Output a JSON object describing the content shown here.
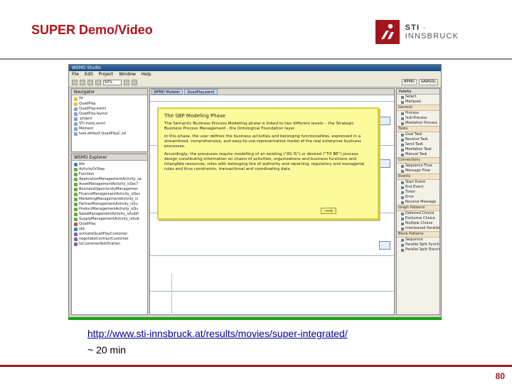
{
  "slide": {
    "title": "SUPER Demo/Video",
    "logo_text_bold": "STI",
    "logo_text": " · INNSBRUCK",
    "page_number": "80",
    "link": "http://www.sti-innsbruck.at/results/movies/super-integrated/",
    "duration": "~ 20 min",
    "accent_color": "#a3151c"
  },
  "app": {
    "window_title": "WSMO Studio",
    "menu": [
      "File",
      "Edit",
      "Project",
      "Window",
      "Help"
    ],
    "zoom": "50%",
    "perspectives": [
      "BPMO",
      "SAWSDL"
    ],
    "navigator": {
      "tab_label": "Navigator",
      "items": [
        {
          "label": "TP",
          "icon": "folder-icon"
        },
        {
          "label": "QuadPlay",
          "icon": "folder-icon"
        },
        {
          "label": "QuadPlay.ewml",
          "icon": "file-icon"
        },
        {
          "label": "QuadPlay.layout",
          "icon": "file-icon"
        },
        {
          "label": ".project",
          "icon": "file-icon"
        },
        {
          "label": "STI-meta.wsml",
          "icon": "file-icon"
        },
        {
          "label": "Moment",
          "icon": "file-icon"
        },
        {
          "label": "task.default.QuadPlayC.sd",
          "icon": "file-icon"
        }
      ]
    },
    "explorer": {
      "tab_label": "WSMO Explorer",
      "items": [
        {
          "label": "bfe",
          "icon": "ontology-icon"
        },
        {
          "label": "ActivityOrStep",
          "icon": "concept-icon"
        },
        {
          "label": "Function",
          "icon": "concept-icon"
        },
        {
          "label": "ApplicationManagementActivity_sa",
          "icon": "concept-icon"
        },
        {
          "label": "AssetManagementActivity_isSec?",
          "icon": "concept-icon"
        },
        {
          "label": "BusinessOpportunityManagemen",
          "icon": "concept-icon"
        },
        {
          "label": "FinanceManagementActivity_isSec",
          "icon": "concept-icon"
        },
        {
          "label": "MarketingManagementActivity_is",
          "icon": "concept-icon"
        },
        {
          "label": "PartnerManagementActivity_isSu",
          "icon": "concept-icon"
        },
        {
          "label": "ProductManagementActivity_isSu",
          "icon": "concept-icon"
        },
        {
          "label": "SalesManagementActivity_isSubP",
          "icon": "concept-icon"
        },
        {
          "label": "SupplyManagementActivity_isSub",
          "icon": "concept-icon"
        },
        {
          "label": "QuadPlay",
          "icon": "process-icon"
        },
        {
          "label": "sbc",
          "icon": "ontology-icon"
        },
        {
          "label": "activateQuadPlayCustomer",
          "icon": "instance-icon"
        },
        {
          "label": "negotiateContractCustomer",
          "icon": "instance-icon"
        },
        {
          "label": "toCustomerNotification",
          "icon": "instance-icon"
        }
      ]
    },
    "editor_tabs": [
      "BPMO Modeler",
      "QuadPlay.ewml"
    ],
    "palette": {
      "title": "Palette",
      "entries": [
        {
          "kind": "item",
          "label": "Select"
        },
        {
          "kind": "item",
          "label": "Marquee"
        },
        {
          "kind": "group",
          "label": "General"
        },
        {
          "kind": "item",
          "label": "Process"
        },
        {
          "kind": "item",
          "label": "Sub-Process"
        },
        {
          "kind": "item",
          "label": "Mediation Process"
        },
        {
          "kind": "group",
          "label": "Tasks"
        },
        {
          "kind": "item",
          "label": "Goal Task"
        },
        {
          "kind": "item",
          "label": "Receive Task"
        },
        {
          "kind": "item",
          "label": "Send Task"
        },
        {
          "kind": "item",
          "label": "Mediation Task"
        },
        {
          "kind": "item",
          "label": "Manual Task"
        },
        {
          "kind": "group",
          "label": "Connections"
        },
        {
          "kind": "item",
          "label": "Sequence Flow"
        },
        {
          "kind": "item",
          "label": "Message Flow"
        },
        {
          "kind": "group",
          "label": "Events"
        },
        {
          "kind": "item",
          "label": "Start Event"
        },
        {
          "kind": "item",
          "label": "End Event"
        },
        {
          "kind": "item",
          "label": "Timer"
        },
        {
          "kind": "item",
          "label": "Error"
        },
        {
          "kind": "item",
          "label": "Receive Message"
        },
        {
          "kind": "group",
          "label": "Graph Patterns"
        },
        {
          "kind": "item",
          "label": "Deferred Choice"
        },
        {
          "kind": "item",
          "label": "Exclusive Choice"
        },
        {
          "kind": "item",
          "label": "Multiple Choice"
        },
        {
          "kind": "item",
          "label": "Interleaved Parallel Routing"
        },
        {
          "kind": "group",
          "label": "Block Patterns"
        },
        {
          "kind": "item",
          "label": "Sequence"
        },
        {
          "kind": "item",
          "label": "Parallel Split Synchronize"
        },
        {
          "kind": "item",
          "label": "Parallel Split Discriminator"
        }
      ]
    },
    "tooltip": {
      "title": "The SBP Modeling Phase",
      "paragraph1": "The Semantic Business Process Modelling phase is linked to two different levels: - the Strategic Business Process Management - the Ontological Foundation layer.",
      "paragraph2": "In this phase, the user defines the business activities and belonging functionalities, expressed in a streamlined, comprehensive, and easy-to-use representative model of the real enterprise business processes.",
      "paragraph3": "Accordingly, the processes require modelling of an existing (\"AS IS\") or desired (\"TO BE\") process design constituting information on chains of activities, organizations and business functions and intangible resources, roles with belonging line of authority and reporting, regulatory and managerial rules and thus constraints, transactional and coordinating data.",
      "next_label": "⟶"
    }
  }
}
